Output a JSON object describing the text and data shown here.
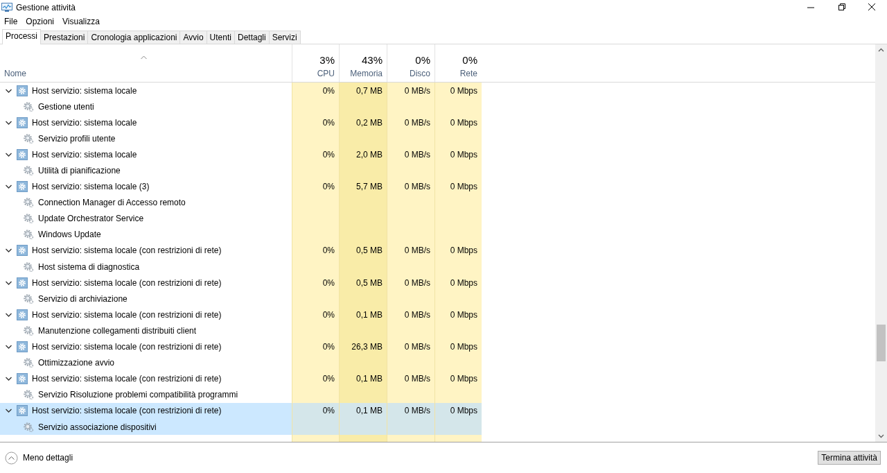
{
  "window": {
    "title": "Gestione attività"
  },
  "menu": [
    "File",
    "Opzioni",
    "Visualizza"
  ],
  "tabs": [
    {
      "label": "Processi",
      "selected": true
    },
    {
      "label": "Prestazioni",
      "selected": false
    },
    {
      "label": "Cronologia applicazioni",
      "selected": false
    },
    {
      "label": "Avvio",
      "selected": false
    },
    {
      "label": "Utenti",
      "selected": false
    },
    {
      "label": "Dettagli",
      "selected": false
    },
    {
      "label": "Servizi",
      "selected": false
    }
  ],
  "table": {
    "name_column": "Nome",
    "columns": [
      {
        "percent": "3%",
        "label": "CPU"
      },
      {
        "percent": "43%",
        "label": "Memoria"
      },
      {
        "percent": "0%",
        "label": "Disco"
      },
      {
        "percent": "0%",
        "label": "Rete"
      }
    ],
    "processes": [
      {
        "name": "Host servizio: sistema locale",
        "expanded": true,
        "selected": false,
        "values": [
          "0%",
          "0,7 MB",
          "0 MB/s",
          "0 Mbps"
        ],
        "children": [
          {
            "name": "Gestione utenti"
          }
        ]
      },
      {
        "name": "Host servizio: sistema locale",
        "expanded": true,
        "selected": false,
        "values": [
          "0%",
          "0,2 MB",
          "0 MB/s",
          "0 Mbps"
        ],
        "children": [
          {
            "name": "Servizio profili utente"
          }
        ]
      },
      {
        "name": "Host servizio: sistema locale",
        "expanded": true,
        "selected": false,
        "values": [
          "0%",
          "2,0 MB",
          "0 MB/s",
          "0 Mbps"
        ],
        "children": [
          {
            "name": "Utilità di pianificazione"
          }
        ]
      },
      {
        "name": "Host servizio: sistema locale (3)",
        "expanded": true,
        "selected": false,
        "values": [
          "0%",
          "5,7 MB",
          "0 MB/s",
          "0 Mbps"
        ],
        "children": [
          {
            "name": "Connection Manager di Accesso remoto"
          },
          {
            "name": "Update Orchestrator Service"
          },
          {
            "name": "Windows Update"
          }
        ]
      },
      {
        "name": "Host servizio: sistema locale (con restrizioni di rete)",
        "expanded": true,
        "selected": false,
        "values": [
          "0%",
          "0,5 MB",
          "0 MB/s",
          "0 Mbps"
        ],
        "children": [
          {
            "name": "Host sistema di diagnostica"
          }
        ]
      },
      {
        "name": "Host servizio: sistema locale (con restrizioni di rete)",
        "expanded": true,
        "selected": false,
        "values": [
          "0%",
          "0,5 MB",
          "0 MB/s",
          "0 Mbps"
        ],
        "children": [
          {
            "name": "Servizio di archiviazione"
          }
        ]
      },
      {
        "name": "Host servizio: sistema locale (con restrizioni di rete)",
        "expanded": true,
        "selected": false,
        "values": [
          "0%",
          "0,1 MB",
          "0 MB/s",
          "0 Mbps"
        ],
        "children": [
          {
            "name": "Manutenzione collegamenti distribuiti client"
          }
        ]
      },
      {
        "name": "Host servizio: sistema locale (con restrizioni di rete)",
        "expanded": true,
        "selected": false,
        "values": [
          "0%",
          "26,3 MB",
          "0 MB/s",
          "0 Mbps"
        ],
        "children": [
          {
            "name": "Ottimizzazione avvio"
          }
        ]
      },
      {
        "name": "Host servizio: sistema locale (con restrizioni di rete)",
        "expanded": true,
        "selected": false,
        "values": [
          "0%",
          "0,1 MB",
          "0 MB/s",
          "0 Mbps"
        ],
        "children": [
          {
            "name": "Servizio Risoluzione problemi compatibilità programmi"
          }
        ]
      },
      {
        "name": "Host servizio: sistema locale (con restrizioni di rete)",
        "expanded": true,
        "selected": true,
        "values": [
          "0%",
          "0,1 MB",
          "0 MB/s",
          "0 Mbps"
        ],
        "children": [
          {
            "name": "Servizio associazione dispositivi"
          }
        ]
      }
    ]
  },
  "footer": {
    "link": "Meno dettagli",
    "button": "Termina attività"
  }
}
